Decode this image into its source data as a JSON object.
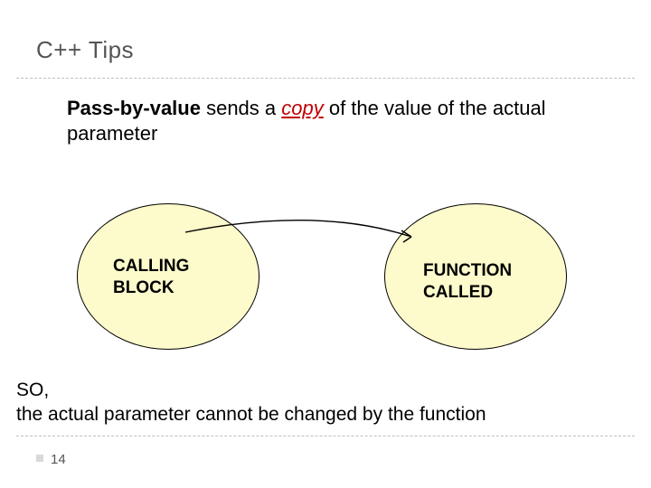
{
  "title": "C++ Tips",
  "desc": {
    "strong": "Pass-by-value",
    "mid1": " sends a ",
    "emph": "copy",
    "mid2": " of the value of the actual parameter"
  },
  "ellipse_left_label_line1": "CALLING",
  "ellipse_left_label_line2": "BLOCK",
  "ellipse_right_label_line1": "FUNCTION",
  "ellipse_right_label_line2": "CALLED",
  "so_line1": "SO,",
  "so_line2": "the actual parameter cannot be changed by the function",
  "page_number": "14"
}
